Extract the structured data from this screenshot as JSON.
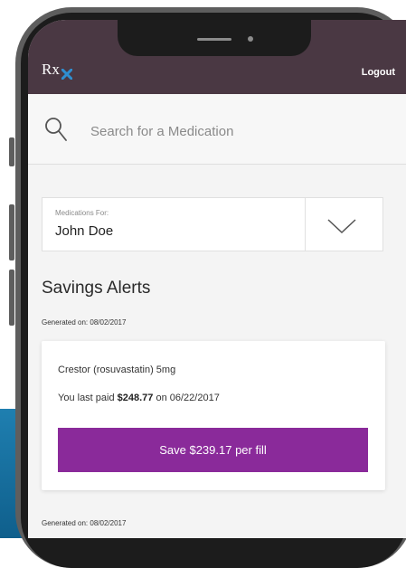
{
  "app": {
    "logo_text": "Rx",
    "logout_label": "Logout"
  },
  "search": {
    "placeholder": "Search for a Medication"
  },
  "medications_for": {
    "label": "Medications For:",
    "name": "John Doe"
  },
  "savings": {
    "title": "Savings Alerts",
    "alerts": [
      {
        "generated": "Generated on: 08/02/2017",
        "drug": "Crestor (rosuvastatin) 5mg",
        "paid_prefix": "You last paid ",
        "paid_amount": "$248.77",
        "paid_suffix": " on 06/22/2017",
        "button_label": "Save $239.17 per fill"
      },
      {
        "generated": "Generated on: 08/02/2017"
      }
    ]
  },
  "colors": {
    "header": "#4a3843",
    "accent_button": "#8a2a9a",
    "logo_accent": "#2f8fd0",
    "background_blue": "#1f7fb0"
  },
  "icons": [
    "rx-logo-icon",
    "search-icon",
    "chevron-down-icon"
  ]
}
